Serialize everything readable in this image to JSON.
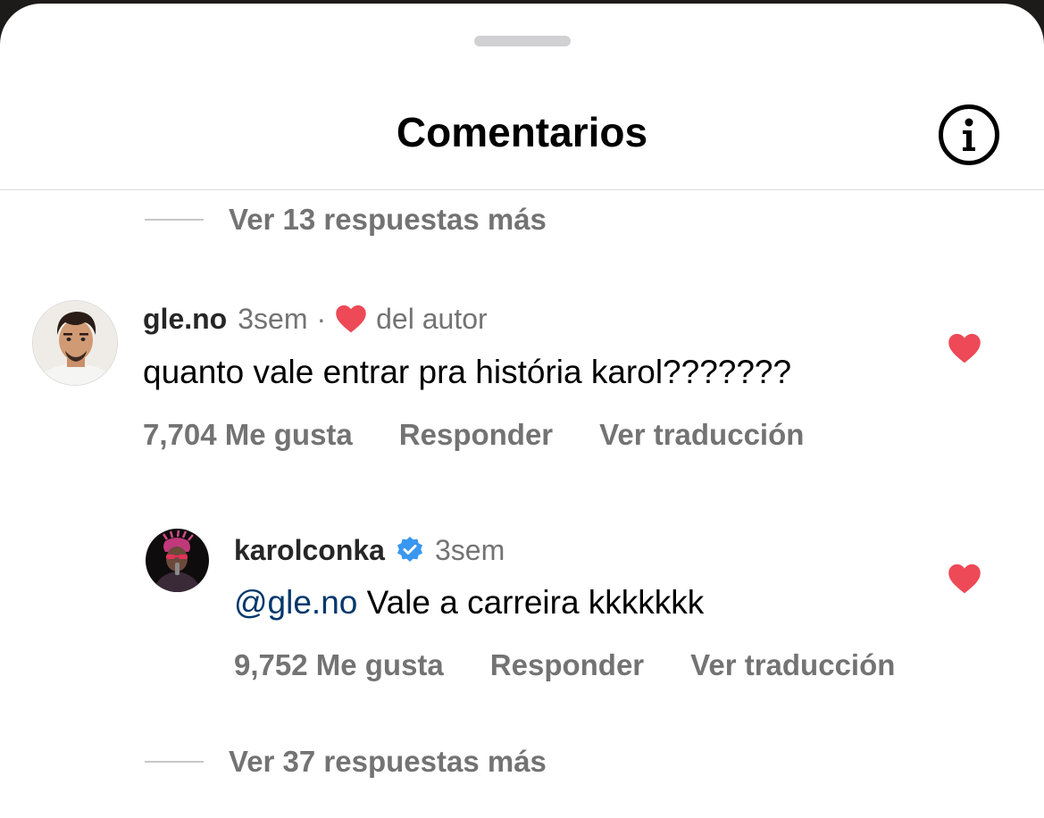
{
  "header": {
    "title": "Comentarios",
    "info_icon": "info-circle-icon"
  },
  "top_replies": {
    "label": "Ver 13 respuestas más"
  },
  "comments": [
    {
      "username": "gle.no",
      "time": "3sem",
      "separator": "·",
      "author_badge": "del autor",
      "text": "quanto vale entrar pra história karol???????",
      "likes": "7,704 Me gusta",
      "reply_label": "Responder",
      "translate_label": "Ver traducción",
      "liked": true
    },
    {
      "username": "karolconka",
      "verified": true,
      "time": "3sem",
      "mention": "@gle.no",
      "text": " Vale a carreira kkkkkkk",
      "likes": "9,752 Me gusta",
      "reply_label": "Responder",
      "translate_label": "Ver traducción",
      "liked": true
    }
  ],
  "bottom_replies": {
    "label": "Ver 37 respuestas más"
  },
  "colors": {
    "heart": "#ed4956",
    "verified": "#3897f0",
    "mention": "#00376b",
    "secondary_text": "#737373"
  }
}
